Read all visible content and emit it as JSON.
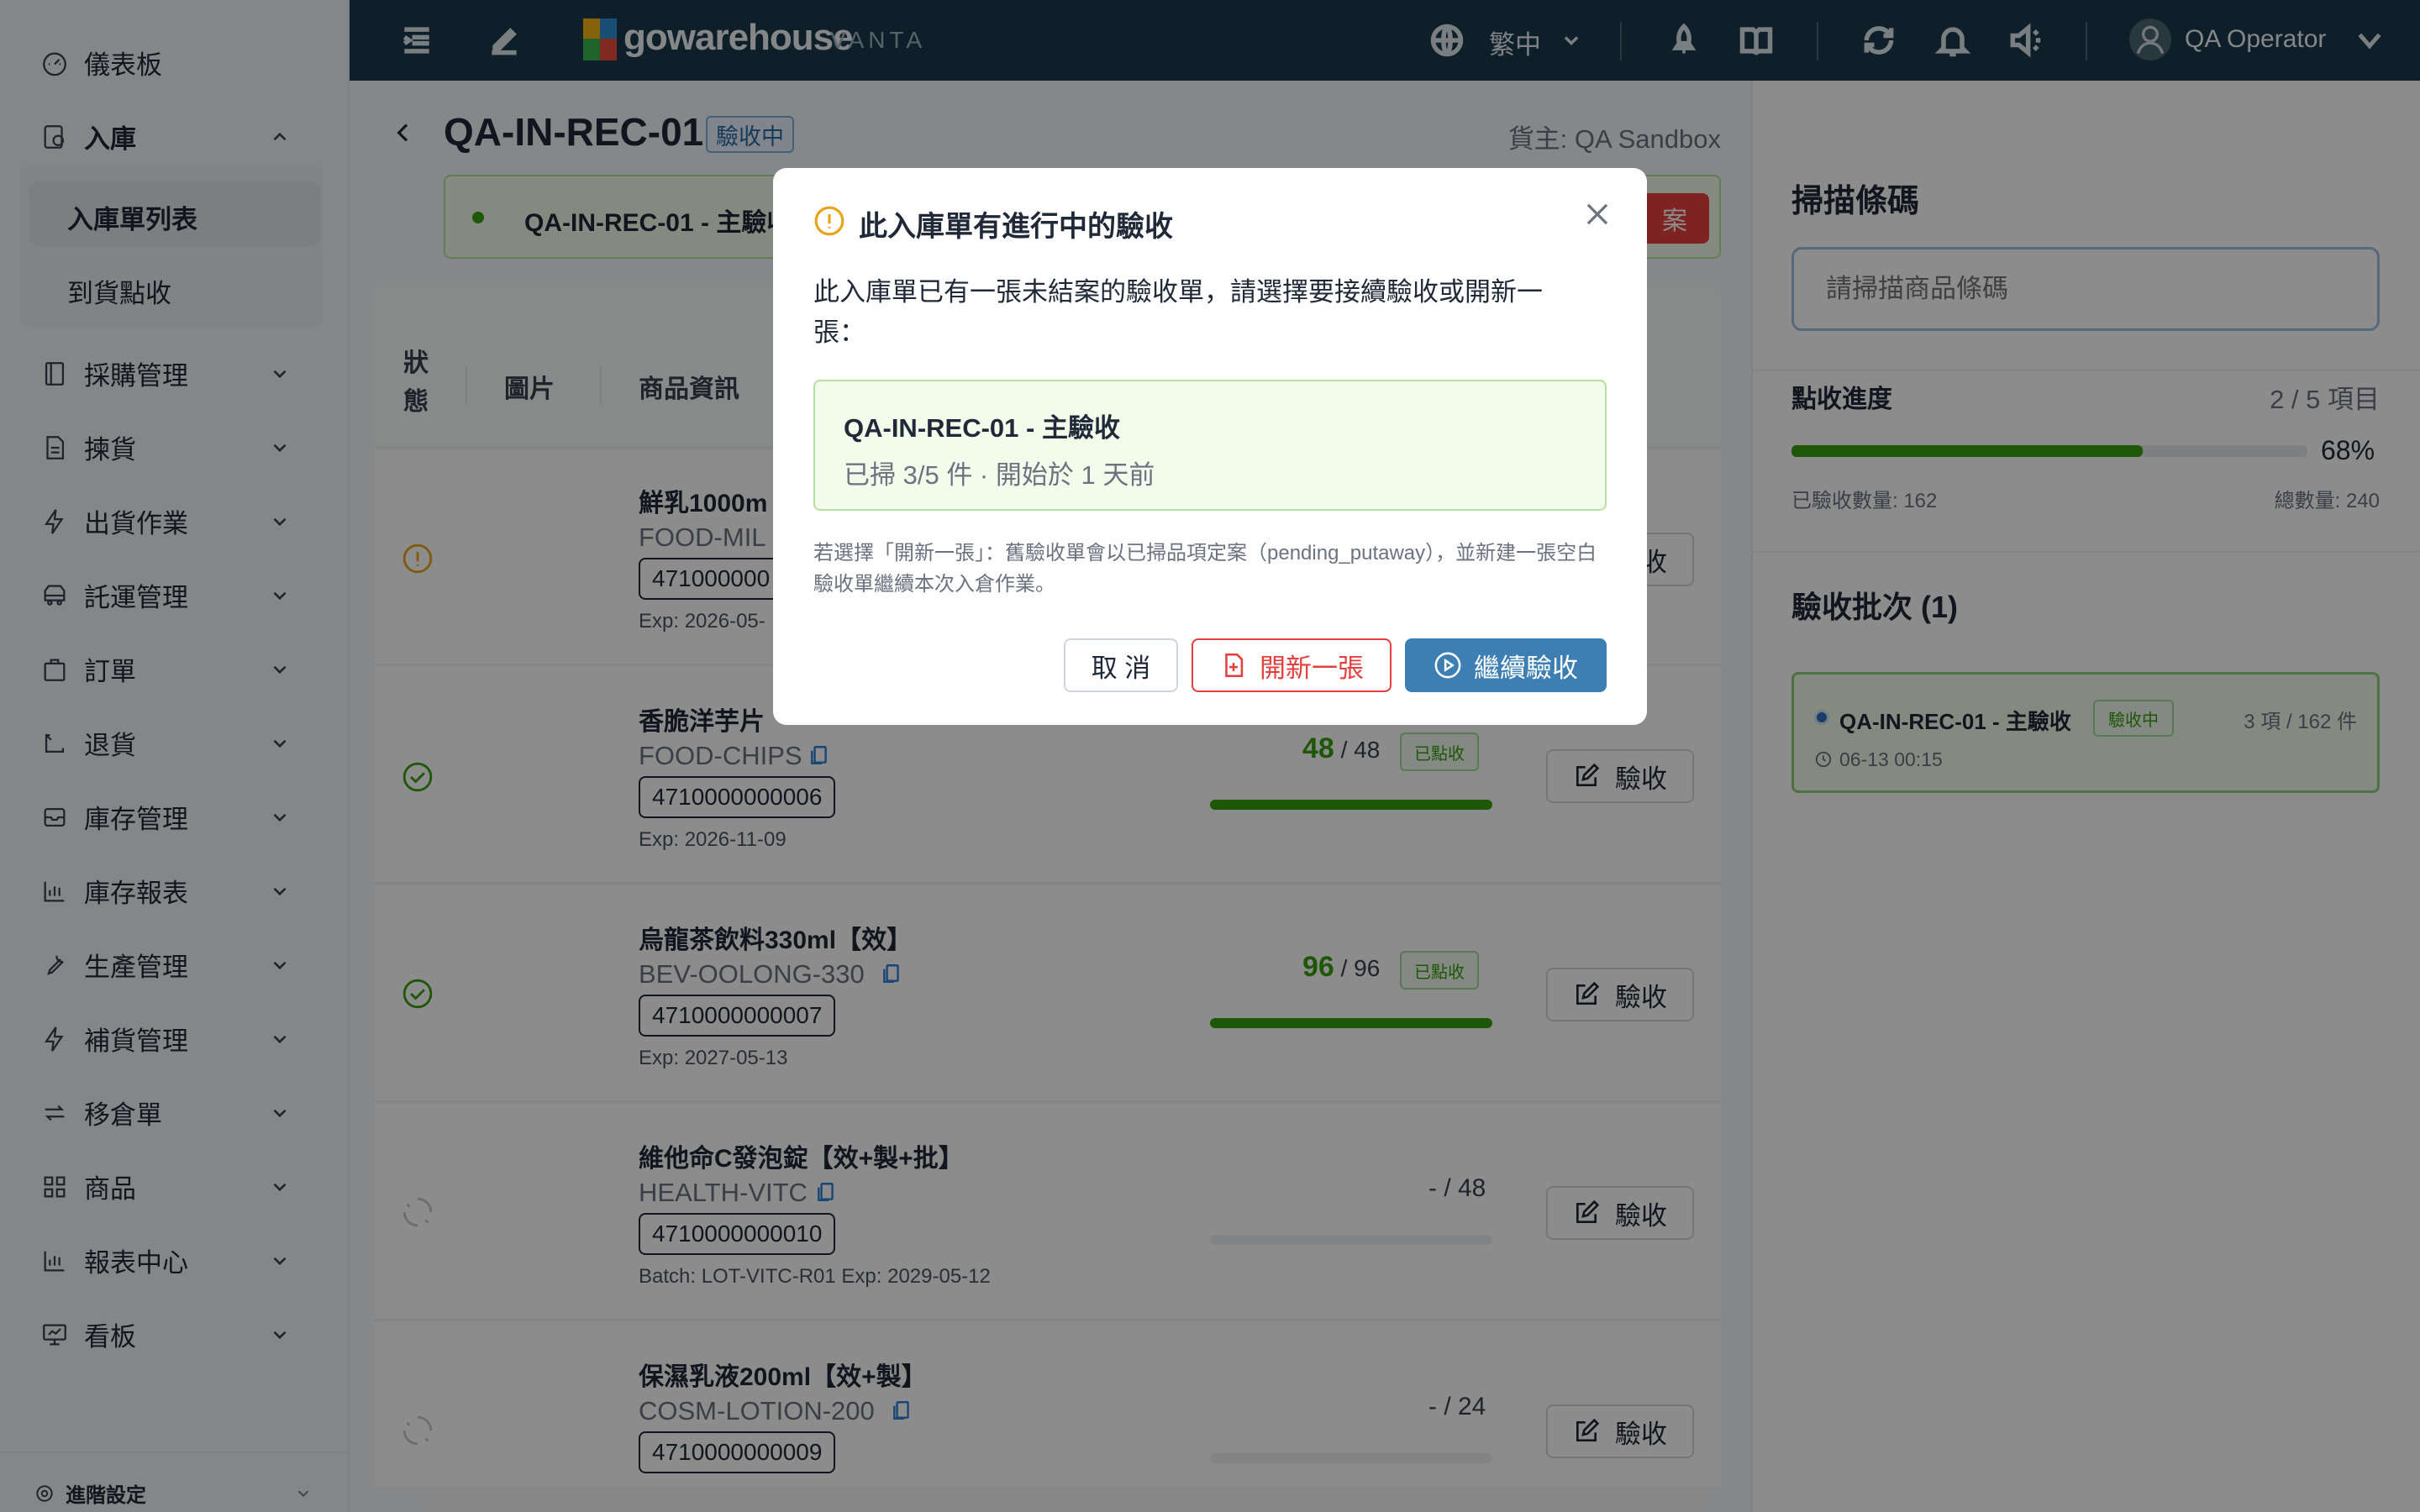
{
  "sidebar": {
    "items": [
      {
        "label": "儀表板",
        "icon": "dashboard-icon"
      },
      {
        "label": "入庫",
        "icon": "inbound-icon"
      },
      {
        "label": "採購管理",
        "icon": "purchase-icon"
      },
      {
        "label": "揀貨",
        "icon": "picking-icon"
      },
      {
        "label": "出貨作業",
        "icon": "bolt-icon"
      },
      {
        "label": "託運管理",
        "icon": "truck-icon"
      },
      {
        "label": "訂單",
        "icon": "bag-icon"
      },
      {
        "label": "退貨",
        "icon": "return-icon"
      },
      {
        "label": "庫存管理",
        "icon": "archive-icon"
      },
      {
        "label": "庫存報表",
        "icon": "chart-icon"
      },
      {
        "label": "生產管理",
        "icon": "wrench-icon"
      },
      {
        "label": "補貨管理",
        "icon": "bolt-icon"
      },
      {
        "label": "移倉單",
        "icon": "transfer-icon"
      },
      {
        "label": "商品",
        "icon": "grid-icon"
      },
      {
        "label": "報表中心",
        "icon": "chart-icon"
      },
      {
        "label": "看板",
        "icon": "board-icon"
      }
    ],
    "subitems": [
      "入庫單列表",
      "到貨點收"
    ],
    "footer": "進階設定"
  },
  "header": {
    "brand": "gowarehouse",
    "brand_sub": "VANTA",
    "language": "繁中",
    "user": "QA Operator"
  },
  "page": {
    "title": "QA-IN-REC-01",
    "status": "驗收中",
    "owner": "貨主: QA Sandbox",
    "banner": "QA-IN-REC-01 - 主驗收",
    "banner_btn": "案",
    "columns": [
      "狀態",
      "圖片",
      "商品資訊"
    ],
    "action_label": "驗收",
    "items": [
      {
        "name": "鮮乳1000m",
        "sku": "FOOD-MIL",
        "code": "471000000",
        "meta": "Exp: 2026-05-",
        "status": "warning"
      },
      {
        "name": "香脆洋芋片",
        "sku": "FOOD-CHIPS",
        "code": "4710000000006",
        "meta": "Exp: 2026-11-09",
        "qty": "48",
        "total": "/ 48",
        "tag": "已點收",
        "progress": 1.0,
        "status": "done"
      },
      {
        "name": "烏龍茶飲料330ml【效】",
        "sku": "BEV-OOLONG-330",
        "code": "4710000000007",
        "meta": "Exp: 2027-05-13",
        "qty": "96",
        "total": "/ 96",
        "tag": "已點收",
        "progress": 1.0,
        "status": "done"
      },
      {
        "name": "維他命C發泡錠【效+製+批】",
        "sku": "HEALTH-VITC",
        "code": "4710000000010",
        "meta": "Batch: LOT-VITC-R01   Exp: 2029-05-12",
        "qty_text": "- / 48",
        "progress": 0,
        "status": "pending"
      },
      {
        "name": "保濕乳液200ml【效+製】",
        "sku": "COSM-LOTION-200",
        "code": "4710000000009",
        "meta": "",
        "qty_text": "- / 24",
        "progress": 0,
        "status": "pending"
      }
    ]
  },
  "panel": {
    "scan_title": "掃描條碼",
    "scan_placeholder": "請掃描商品條碼",
    "progress_title": "點收進度",
    "progress_items": "2 / 5 項目",
    "progress_percent": "68%",
    "progress_value": 0.68,
    "received_label": "已驗收數量: 162",
    "total_label": "總數量: 240",
    "batch_title": "驗收批次 (1)",
    "batch_name": "QA-IN-REC-01 - 主驗收",
    "batch_status": "驗收中",
    "batch_count": "3 項 / 162 件",
    "batch_time": "06-13 00:15"
  },
  "modal": {
    "title": "此入庫單有進行中的驗收",
    "message": "此入庫單已有一張未結案的驗收單，請選擇要接續驗收或開新一張：",
    "session_name": "QA-IN-REC-01 - 主驗收",
    "session_meta": "已掃 3/5 件 · 開始於 1 天前",
    "note": "若選擇「開新一張」：舊驗收單會以已掃品項定案（pending_putaway），並新建一張空白驗收單繼續本次入倉作業。",
    "cancel": "取 消",
    "new_btn": "開新一張",
    "continue_btn": "繼續驗收"
  },
  "colors": {
    "header_bg": "#1a3a4c",
    "accent": "#3d7fb3",
    "success": "#389e0d",
    "danger": "#e53e3e",
    "warning": "#e8a317"
  }
}
